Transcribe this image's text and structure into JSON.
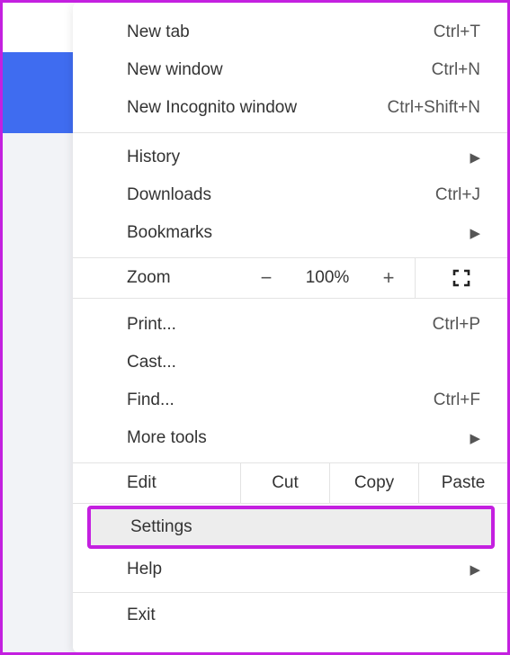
{
  "menu": {
    "new_tab": {
      "label": "New tab",
      "shortcut": "Ctrl+T"
    },
    "new_window": {
      "label": "New window",
      "shortcut": "Ctrl+N"
    },
    "new_incognito": {
      "label": "New Incognito window",
      "shortcut": "Ctrl+Shift+N"
    },
    "history": {
      "label": "History"
    },
    "downloads": {
      "label": "Downloads",
      "shortcut": "Ctrl+J"
    },
    "bookmarks": {
      "label": "Bookmarks"
    },
    "zoom": {
      "label": "Zoom",
      "minus": "−",
      "value": "100%",
      "plus": "+"
    },
    "print": {
      "label": "Print...",
      "shortcut": "Ctrl+P"
    },
    "cast": {
      "label": "Cast..."
    },
    "find": {
      "label": "Find...",
      "shortcut": "Ctrl+F"
    },
    "more_tools": {
      "label": "More tools"
    },
    "edit": {
      "label": "Edit",
      "cut": "Cut",
      "copy": "Copy",
      "paste": "Paste"
    },
    "settings": {
      "label": "Settings"
    },
    "help": {
      "label": "Help"
    },
    "exit": {
      "label": "Exit"
    }
  }
}
